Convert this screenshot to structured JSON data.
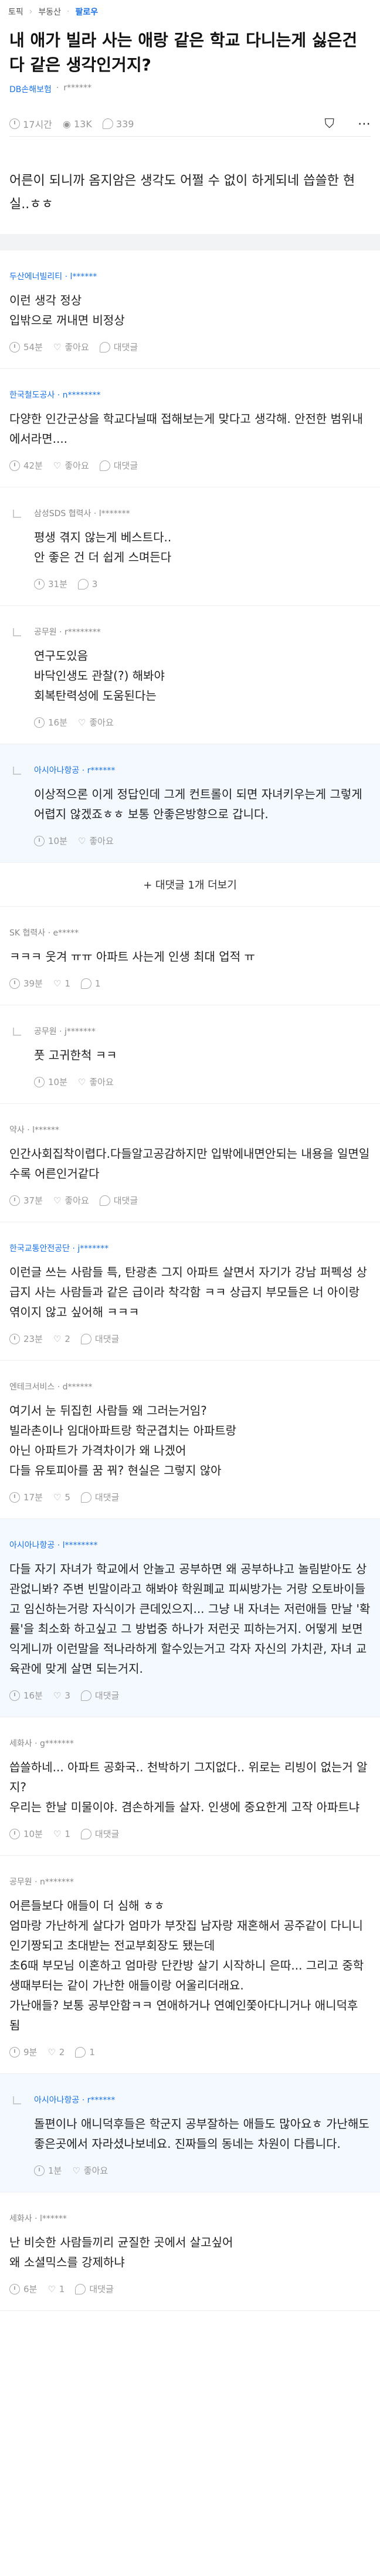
{
  "topbar": {
    "section": "토픽",
    "category": "부동산",
    "follow": "팔로우"
  },
  "post": {
    "title": "내 애가 빌라 사는 애랑 같은 학교 다니는게 싫은건 다 같은 생각인거지?",
    "author_company": "DB손해보험",
    "author_id": "r******",
    "time": "17시간",
    "views": "13K",
    "comments": "339",
    "body": "어른이 되니까 옴지암은 생각도 어쩔 수 없이 하게되네 씁쓸한 현실..ㅎㅎ"
  },
  "comments": [
    {
      "author": "두산에너빌리티 · l******",
      "blue": true,
      "reply": false,
      "highlight": false,
      "text": "이런 생각 정상\n입밖으로 꺼내면 비정상",
      "time": "54분",
      "likes": "좋아요",
      "replies": "대댓글"
    },
    {
      "author": "한국철도공사 · n********",
      "blue": true,
      "reply": false,
      "highlight": false,
      "text": "다양한 인간군상을 학교다닐때 접해보는게 맞다고 생각해. 안전한 범위내에서라면....",
      "time": "42분",
      "likes": "좋아요",
      "replies": "대댓글"
    },
    {
      "author": "삼성SDS 협력사 · l*******",
      "blue": false,
      "reply": true,
      "highlight": false,
      "text": "평생 겪지 않는게 베스트다..\n안 좋은 건 더 쉽게 스며든다",
      "time": "31분",
      "likes": "",
      "replies": "3"
    },
    {
      "author": "공무원 · r********",
      "blue": false,
      "reply": true,
      "highlight": false,
      "text": "연구도있음\n바닥인생도 관찰(?) 해봐야\n회복탄력성에 도움된다는",
      "time": "16분",
      "likes": "좋아요",
      "replies": ""
    },
    {
      "author": "아시아나항공 · r******",
      "blue": true,
      "reply": true,
      "highlight": true,
      "text": "이상적으론 이게 정답인데 그게 컨트롤이 되면 자녀키우는게 그렇게 어렵지 않겠죠ㅎㅎ 보통 안좋은방향으로 갑니다.",
      "time": "10분",
      "likes": "좋아요",
      "replies": ""
    }
  ],
  "more_replies": "+ 대댓글 1개 더보기",
  "comments2": [
    {
      "author": "SK 협력사 · e*****",
      "blue": false,
      "reply": false,
      "highlight": false,
      "text": "ㅋㅋㅋ 웃겨 ㅠㅠ 아파트 사는게 인생 최대 업적 ㅠ",
      "time": "39분",
      "likes": "1",
      "replies": "1"
    },
    {
      "author": "공무원 · j*******",
      "blue": false,
      "reply": true,
      "highlight": false,
      "text": "풋 고귀한척 ㅋㅋ",
      "time": "10분",
      "likes": "좋아요",
      "replies": ""
    },
    {
      "author": "약사 · l******",
      "blue": false,
      "reply": false,
      "highlight": false,
      "text": "인간사회집착이렵다.다들알고공감하지만 입밖에내면안되는 내용을 일면일수록 어른인거같다",
      "time": "37분",
      "likes": "좋아요",
      "replies": "대댓글"
    },
    {
      "author": "한국교통안전공단 · j*******",
      "blue": true,
      "reply": false,
      "highlight": false,
      "text": "이런글 쓰는 사람들 특, 탄광촌 그지 아파트 살면서 자기가 강남 퍼펙성 상급지 사는 사람들과 같은 급이라 착각함 ㅋㅋ 상급지 부모들은 너 아이랑 엮이지 않고 싶어해 ㅋㅋㅋ",
      "time": "23분",
      "likes": "2",
      "replies": "대댓글"
    },
    {
      "author": "엔테크서비스 · d******",
      "blue": false,
      "reply": false,
      "highlight": false,
      "text": "여기서 눈 뒤집힌 사람들 왜 그러는거임?\n빌라촌이나 임대아파트랑 학군겹치는 아파트랑\n아닌 아파트가 가격차이가 왜 나겠어\n다들 유토피아를 꿈 꿔? 현실은 그렇지 않아",
      "time": "17분",
      "likes": "5",
      "replies": "대댓글"
    },
    {
      "author": "아시아나항공 · l********",
      "blue": true,
      "reply": false,
      "highlight": true,
      "text": "다들 자기 자녀가 학교에서 안놀고 공부하면 왜 공부하냐고 놀림받아도 상관없니봐? 주변 빈말이라고 해봐야 학원폐교 피씨방가는 거랑 오토바이들고 임신하는거랑 자식이가 큰데있으지... 그냥 내 자녀는 저런애들 만날 '확률'을 최소화 하고싶고 그 방법중 하나가 저런곳 피하는거지. 어떻게 보면 익게니까 이런말을 적나라하게 할수있는거고 각자 자신의 가치관, 자녀 교육관에 맞게 살면 되는거지.",
      "time": "16분",
      "likes": "3",
      "replies": "대댓글"
    },
    {
      "author": "세화사 · g*******",
      "blue": false,
      "reply": false,
      "highlight": false,
      "text": "씁쓸하네... 아파트 공화국.. 천박하기 그지없다.. 위로는 리빙이 없는거 알지?\n우리는 한날 미물이야. 겸손하게들 살자. 인생에 중요한게 고작 아파트냐",
      "time": "10분",
      "likes": "1",
      "replies": "대댓글"
    },
    {
      "author": "공무원 · n*******",
      "blue": false,
      "reply": false,
      "highlight": false,
      "text": "어른들보다 애들이 더 심해 ㅎㅎ\n엄마랑 가난하게 살다가 엄마가 부잣집 남자랑 재혼해서 공주같이 다니니 인기짱되고 초대받는 전교부회장도 됐는데\n초6때 부모님 이혼하고 엄마랑 단칸방 살기 시작하니 은따... 그리고 중학생때부터는 같이 가난한 애들이랑 어울리더래요.\n가난애들? 보통 공부안함ㅋㅋ 연애하거나 연예인쫓아다니거나 애니덕후 됨",
      "time": "9분",
      "likes": "2",
      "replies": "1"
    },
    {
      "author": "아시아나항공 · r******",
      "blue": true,
      "reply": true,
      "highlight": true,
      "text": "돌편이나 애니덕후들은 학군지 공부잘하는 애들도 많아요ㅎ 가난해도 좋은곳에서 자라셨나보네요. 진짜들의 동네는 차원이 다릅니다.",
      "time": "1분",
      "likes": "좋아요",
      "replies": ""
    },
    {
      "author": "세화사 · l******",
      "blue": false,
      "reply": false,
      "highlight": false,
      "text": "난 비슷한 사람들끼리 균질한 곳에서 살고싶어\n왜 소셜믹스를 강제하냐",
      "time": "6분",
      "likes": "1",
      "replies": "대댓글"
    }
  ]
}
